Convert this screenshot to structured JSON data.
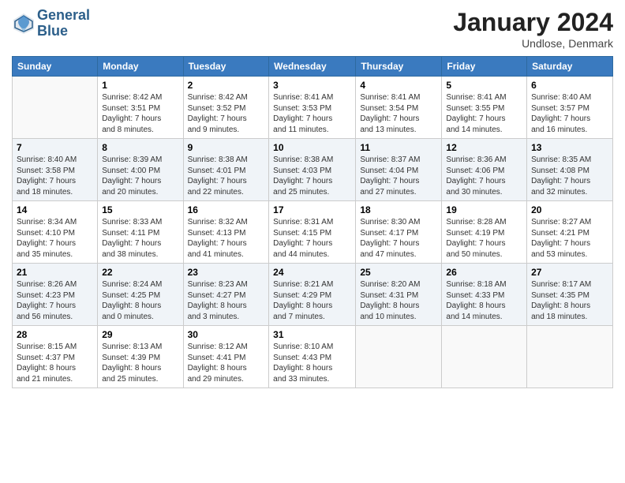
{
  "header": {
    "logo_line1": "General",
    "logo_line2": "Blue",
    "month": "January 2024",
    "location": "Undlose, Denmark"
  },
  "weekdays": [
    "Sunday",
    "Monday",
    "Tuesday",
    "Wednesday",
    "Thursday",
    "Friday",
    "Saturday"
  ],
  "weeks": [
    [
      {
        "day": "",
        "info": ""
      },
      {
        "day": "1",
        "info": "Sunrise: 8:42 AM\nSunset: 3:51 PM\nDaylight: 7 hours\nand 8 minutes."
      },
      {
        "day": "2",
        "info": "Sunrise: 8:42 AM\nSunset: 3:52 PM\nDaylight: 7 hours\nand 9 minutes."
      },
      {
        "day": "3",
        "info": "Sunrise: 8:41 AM\nSunset: 3:53 PM\nDaylight: 7 hours\nand 11 minutes."
      },
      {
        "day": "4",
        "info": "Sunrise: 8:41 AM\nSunset: 3:54 PM\nDaylight: 7 hours\nand 13 minutes."
      },
      {
        "day": "5",
        "info": "Sunrise: 8:41 AM\nSunset: 3:55 PM\nDaylight: 7 hours\nand 14 minutes."
      },
      {
        "day": "6",
        "info": "Sunrise: 8:40 AM\nSunset: 3:57 PM\nDaylight: 7 hours\nand 16 minutes."
      }
    ],
    [
      {
        "day": "7",
        "info": "Sunrise: 8:40 AM\nSunset: 3:58 PM\nDaylight: 7 hours\nand 18 minutes."
      },
      {
        "day": "8",
        "info": "Sunrise: 8:39 AM\nSunset: 4:00 PM\nDaylight: 7 hours\nand 20 minutes."
      },
      {
        "day": "9",
        "info": "Sunrise: 8:38 AM\nSunset: 4:01 PM\nDaylight: 7 hours\nand 22 minutes."
      },
      {
        "day": "10",
        "info": "Sunrise: 8:38 AM\nSunset: 4:03 PM\nDaylight: 7 hours\nand 25 minutes."
      },
      {
        "day": "11",
        "info": "Sunrise: 8:37 AM\nSunset: 4:04 PM\nDaylight: 7 hours\nand 27 minutes."
      },
      {
        "day": "12",
        "info": "Sunrise: 8:36 AM\nSunset: 4:06 PM\nDaylight: 7 hours\nand 30 minutes."
      },
      {
        "day": "13",
        "info": "Sunrise: 8:35 AM\nSunset: 4:08 PM\nDaylight: 7 hours\nand 32 minutes."
      }
    ],
    [
      {
        "day": "14",
        "info": "Sunrise: 8:34 AM\nSunset: 4:10 PM\nDaylight: 7 hours\nand 35 minutes."
      },
      {
        "day": "15",
        "info": "Sunrise: 8:33 AM\nSunset: 4:11 PM\nDaylight: 7 hours\nand 38 minutes."
      },
      {
        "day": "16",
        "info": "Sunrise: 8:32 AM\nSunset: 4:13 PM\nDaylight: 7 hours\nand 41 minutes."
      },
      {
        "day": "17",
        "info": "Sunrise: 8:31 AM\nSunset: 4:15 PM\nDaylight: 7 hours\nand 44 minutes."
      },
      {
        "day": "18",
        "info": "Sunrise: 8:30 AM\nSunset: 4:17 PM\nDaylight: 7 hours\nand 47 minutes."
      },
      {
        "day": "19",
        "info": "Sunrise: 8:28 AM\nSunset: 4:19 PM\nDaylight: 7 hours\nand 50 minutes."
      },
      {
        "day": "20",
        "info": "Sunrise: 8:27 AM\nSunset: 4:21 PM\nDaylight: 7 hours\nand 53 minutes."
      }
    ],
    [
      {
        "day": "21",
        "info": "Sunrise: 8:26 AM\nSunset: 4:23 PM\nDaylight: 7 hours\nand 56 minutes."
      },
      {
        "day": "22",
        "info": "Sunrise: 8:24 AM\nSunset: 4:25 PM\nDaylight: 8 hours\nand 0 minutes."
      },
      {
        "day": "23",
        "info": "Sunrise: 8:23 AM\nSunset: 4:27 PM\nDaylight: 8 hours\nand 3 minutes."
      },
      {
        "day": "24",
        "info": "Sunrise: 8:21 AM\nSunset: 4:29 PM\nDaylight: 8 hours\nand 7 minutes."
      },
      {
        "day": "25",
        "info": "Sunrise: 8:20 AM\nSunset: 4:31 PM\nDaylight: 8 hours\nand 10 minutes."
      },
      {
        "day": "26",
        "info": "Sunrise: 8:18 AM\nSunset: 4:33 PM\nDaylight: 8 hours\nand 14 minutes."
      },
      {
        "day": "27",
        "info": "Sunrise: 8:17 AM\nSunset: 4:35 PM\nDaylight: 8 hours\nand 18 minutes."
      }
    ],
    [
      {
        "day": "28",
        "info": "Sunrise: 8:15 AM\nSunset: 4:37 PM\nDaylight: 8 hours\nand 21 minutes."
      },
      {
        "day": "29",
        "info": "Sunrise: 8:13 AM\nSunset: 4:39 PM\nDaylight: 8 hours\nand 25 minutes."
      },
      {
        "day": "30",
        "info": "Sunrise: 8:12 AM\nSunset: 4:41 PM\nDaylight: 8 hours\nand 29 minutes."
      },
      {
        "day": "31",
        "info": "Sunrise: 8:10 AM\nSunset: 4:43 PM\nDaylight: 8 hours\nand 33 minutes."
      },
      {
        "day": "",
        "info": ""
      },
      {
        "day": "",
        "info": ""
      },
      {
        "day": "",
        "info": ""
      }
    ]
  ]
}
